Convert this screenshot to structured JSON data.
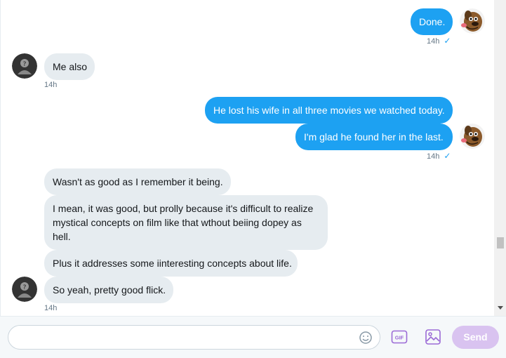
{
  "messages": {
    "m1": {
      "text": "Done.",
      "time": "14h",
      "check": "✓"
    },
    "m2": {
      "text": "Me also",
      "time": "14h"
    },
    "m3": {
      "text": "He lost his wife in all three movies we watched today."
    },
    "m4": {
      "text": "I'm glad he found her in the last.",
      "time": "14h",
      "check": "✓"
    },
    "m5": {
      "text": "Wasn't as good as I remember it being."
    },
    "m6": {
      "text": "I mean, it was good, but prolly because it's difficult to realize mystical concepts on film like that wthout beiing dopey as hell."
    },
    "m7": {
      "text": "Plus it addresses some iinteresting concepts about life."
    },
    "m8": {
      "text": "So yeah, pretty good flick.",
      "time": "14h"
    }
  },
  "composer": {
    "placeholder": "",
    "value": "",
    "emoji_icon": "emoji-icon",
    "gif_label": "GIF",
    "image_icon": "image-icon",
    "send_label": "Send"
  },
  "colors": {
    "sent_bubble": "#1da1f2",
    "received_bubble": "#e6ecf0",
    "send_button_disabled": "#d9c3f0",
    "icon_accent": "#9b6ad6"
  }
}
